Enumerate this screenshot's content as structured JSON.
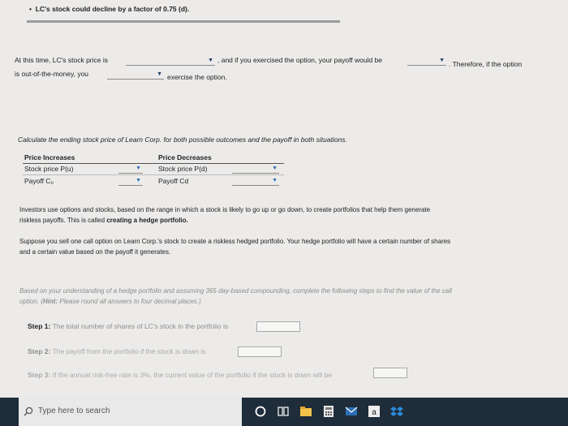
{
  "top_bullet": "LC's stock could decline by a factor of 0.75 (d).",
  "sentence1": {
    "part1": "At this time, LC's stock price is",
    "part2": ", and if you exercised the option, your payoff would be",
    "part3": ". Therefore, if the option",
    "part4": "is out-of-the-money, you",
    "part5": "exercise the option."
  },
  "calc_instruction": "Calculate the ending stock price of Learn Corp. for both possible outcomes and the payoff in both situations.",
  "table": {
    "increase_header": "Price Increases",
    "decrease_header": "Price Decreases",
    "stock_up_label": "Stock price P(u)",
    "stock_down_label": "Stock price P(d)",
    "payoff_up_label": "Payoff Cᵤ",
    "payoff_down_label": "Payoff Cd"
  },
  "para1": {
    "line1": "Investors use options and stocks, based on the range in which a stock is likely to go up or go down, to create portfolios that help them generate",
    "line2_plain": "riskless payoffs. This is called",
    "line2_bold": "creating a hedge portfolio."
  },
  "para2": {
    "line1": "Suppose you sell one call option on Learn Corp.'s stock to create a riskless hedged portfolio. Your hedge portfolio will have a certain number of shares",
    "line2": "and a certain value based on the payoff it generates."
  },
  "para3": {
    "line1": "Based on your understanding of a hedge portfolio and assuming 365 day-based compounding, complete the following steps to find the value of the call",
    "line2_plain": "option. (",
    "line2_bold": "Hint:",
    "line2_rest": "Please round all answers to four decimal places.)"
  },
  "steps": [
    {
      "label": "Step 1:",
      "text": "The total number of shares of LC's stock in the portfolio is"
    },
    {
      "label": "Step 2:",
      "text": "The payoff from the portfolio if the stock is down is"
    },
    {
      "label": "Step 3:",
      "text": "If the annual risk-free rate is 3%, the current value of the portfolio if the stock is down will be"
    }
  ],
  "taskbar": {
    "search_placeholder": "Type here to search"
  }
}
